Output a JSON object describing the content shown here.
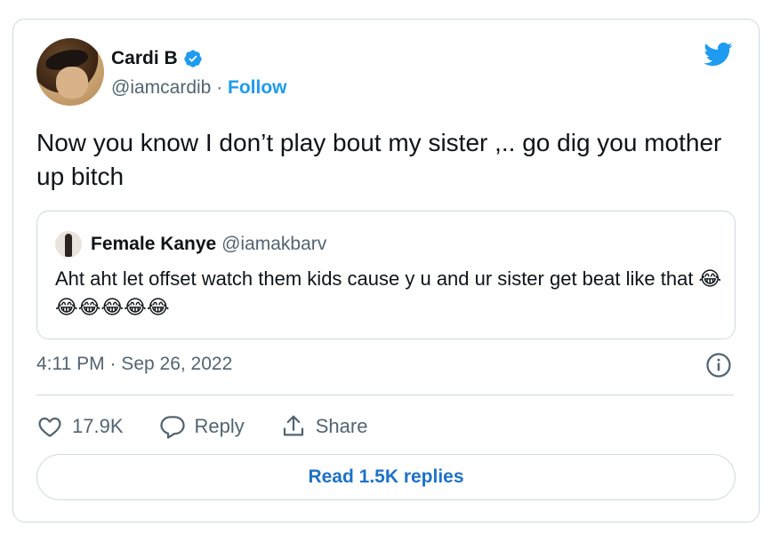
{
  "tweet": {
    "author_name": "Cardi B",
    "handle": "@iamcardib",
    "separator": " · ",
    "follow_label": "Follow",
    "text": "Now you know I don’t play bout my sister ,.. go dig you mother up bitch",
    "timestamp": "4:11 PM · Sep 26, 2022"
  },
  "quote": {
    "author_name": "Female Kanye",
    "handle": "@iamakbarv",
    "text": "Aht aht let offset watch them kids cause y u and ur sister get beat like that 😂😂😂😂😂😂"
  },
  "actions": {
    "like_count": "17.9K",
    "reply_label": "Reply",
    "share_label": "Share"
  },
  "read_replies_label": "Read 1.5K replies",
  "colors": {
    "twitter_blue": "#1d9bf0",
    "text_primary": "#0f1419",
    "text_secondary": "#536471",
    "border": "#cfd9de"
  },
  "icons": [
    "verified-badge-icon",
    "twitter-bird-icon",
    "info-icon",
    "heart-icon",
    "reply-bubble-icon",
    "share-icon"
  ]
}
